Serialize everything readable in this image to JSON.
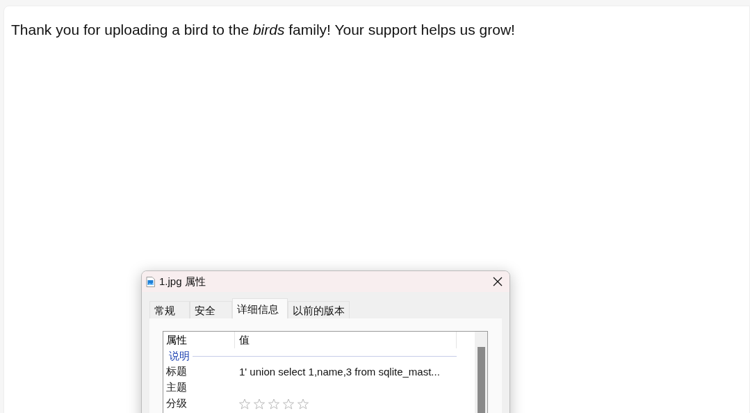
{
  "message": "Thank you for uploading a bird to the *birds* family! Your support helps us grow!",
  "dialog": {
    "title": "1.jpg 属性",
    "tabs": [
      {
        "label": "常规",
        "selected": false
      },
      {
        "label": "安全",
        "selected": false
      },
      {
        "label": "详细信息",
        "selected": true
      },
      {
        "label": "以前的版本",
        "selected": false
      }
    ],
    "columns": [
      "属性",
      "值"
    ],
    "rows": [
      {
        "kind": "group",
        "label": "说明"
      },
      {
        "kind": "text",
        "label": "标题",
        "value": "1' union select 1,name,3 from sqlite_mast..."
      },
      {
        "kind": "text",
        "label": "主题"
      },
      {
        "kind": "rating",
        "label": "分级",
        "stars": 0
      }
    ]
  }
}
